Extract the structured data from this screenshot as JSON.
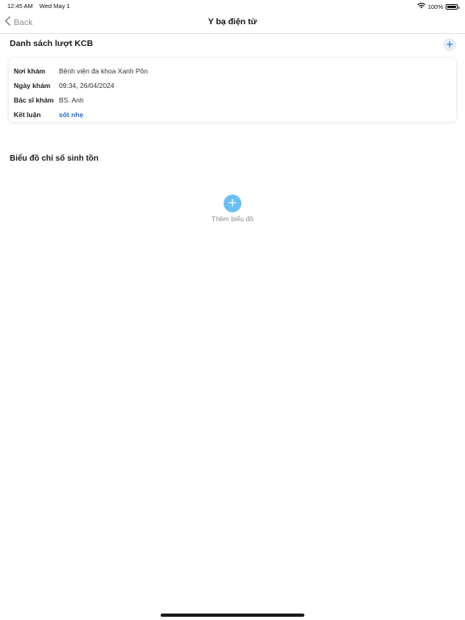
{
  "status_bar": {
    "time": "12:45 AM",
    "date": "Wed May 1",
    "battery": "100%",
    "battery_level": 1.0,
    "wifi_icon": "wifi-icon",
    "battery_icon": "battery-icon"
  },
  "nav": {
    "back_label": "Back",
    "back_icon": "chevron-left-icon",
    "title": "Y bạ điện tử"
  },
  "visits": {
    "title": "Danh sách lượt KCB",
    "add_icon": "plus-icon",
    "items": [
      {
        "rows": [
          {
            "label": "Nơi khám",
            "value": "Bệnh viện đa khoa Xanh Pôn"
          },
          {
            "label": "Ngày khám",
            "value": "09:34, 26/04/2024"
          },
          {
            "label": "Bác sĩ khám",
            "value": "BS. Anh"
          },
          {
            "label": "Kết luận",
            "value": "sốt nhẹ"
          }
        ]
      }
    ]
  },
  "charts": {
    "title": "Biểu đồ chỉ số sinh tồn",
    "add_label": "Thêm biểu đồ",
    "add_icon": "plus-circle-icon"
  },
  "colors": {
    "accent": "#1f6fd1",
    "add_button": "#69c0f5",
    "muted_text": "#8e8e93"
  }
}
